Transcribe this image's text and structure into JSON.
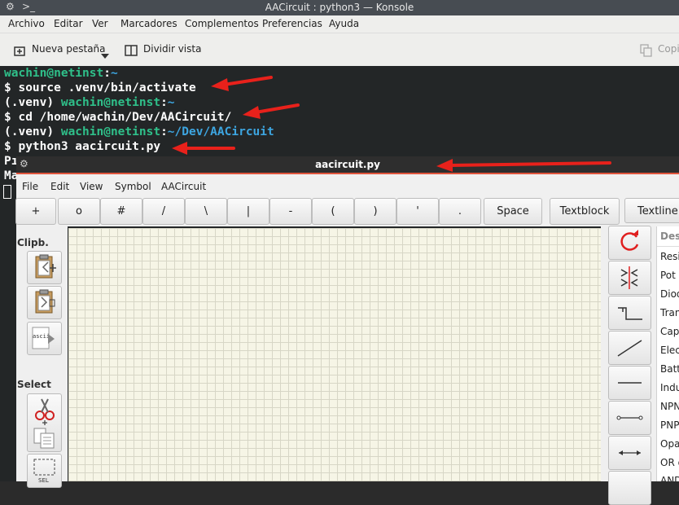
{
  "konsole": {
    "title": "AACircuit : python3 — Konsole",
    "menu": [
      "Archivo",
      "Editar",
      "Ver",
      "Marcadores",
      "Complementos",
      "Preferencias",
      "Ayuda"
    ],
    "toolbar": {
      "new_tab": "Nueva pestaña",
      "split_view": "Dividir vista",
      "copy": "Copi"
    },
    "terminal": {
      "line1_user": "wachin@netinst",
      "line1_sep": ":",
      "line1_path": "~",
      "line2": "$ source .venv/bin/activate",
      "line3_env": "(.venv) ",
      "line3_user": "wachin@netinst",
      "line3_sep": ":",
      "line3_path": "~",
      "line4": "$ cd /home/wachin/Dev/AACircuit/",
      "line5_env": "(.venv) ",
      "line5_user": "wachin@netinst",
      "line5_sep": ":",
      "line5_path": "~/Dev/AACircuit",
      "line6": "$ python3 aacircuit.py",
      "line7": "Pı",
      "line8": "Ma"
    }
  },
  "aacircuit": {
    "title": "aacircuit.py",
    "menu": [
      "File",
      "Edit",
      "View",
      "Symbol",
      "AACircuit"
    ],
    "symbols": [
      "+",
      "o",
      "#",
      "/",
      "\\",
      "|",
      "-",
      "(",
      ")",
      "'",
      ".",
      "Space",
      "Textblock",
      "Textline:"
    ],
    "left": {
      "clipboard_label": "Clipb.",
      "select_label": "Select",
      "ascii_label": "ascii",
      "sel_label": "SEL"
    },
    "components": [
      "Des",
      "Resi",
      "Pot",
      "Diod",
      "Tran",
      "Capa",
      "Elec",
      "Batt",
      "Indu",
      "NPN",
      "PNP",
      "Opa",
      "OR g",
      "AND"
    ]
  },
  "colors": {
    "terminal_bg": "#232627",
    "prompt_green": "#2fc08a",
    "path_blue": "#3da5e0",
    "annotation_red": "#e8211b",
    "accent_orange": "#e0553d"
  }
}
